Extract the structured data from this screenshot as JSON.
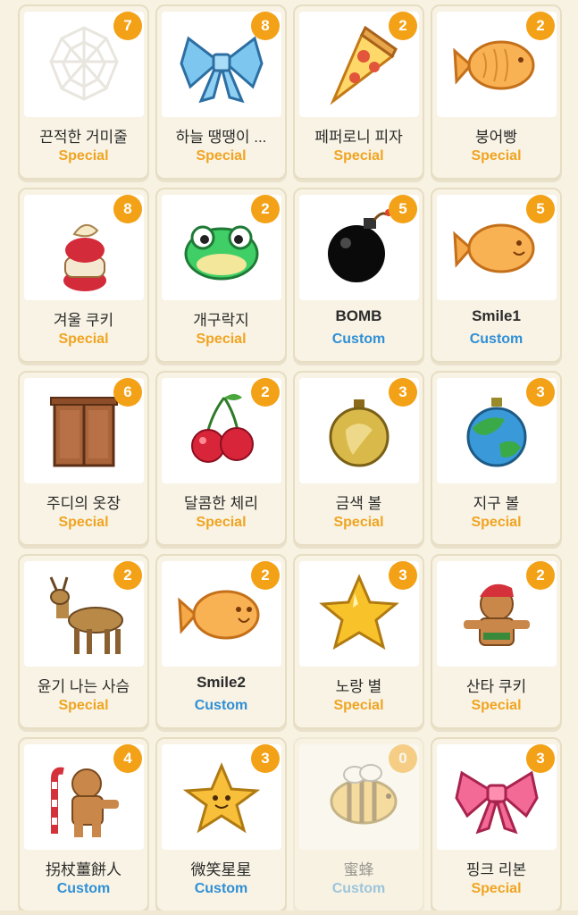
{
  "items": [
    {
      "name": "끈적한 거미줄",
      "category": "Special",
      "count": "7",
      "icon": "spiderweb-icon"
    },
    {
      "name": "하늘 땡땡이 ...",
      "category": "Special",
      "count": "8",
      "icon": "blue-bow-icon"
    },
    {
      "name": "페퍼로니 피자",
      "category": "Special",
      "count": "2",
      "icon": "pizza-icon"
    },
    {
      "name": "붕어빵",
      "category": "Special",
      "count": "2",
      "icon": "fish-bread-icon"
    },
    {
      "name": "겨울 쿠키",
      "category": "Special",
      "count": "8",
      "icon": "winter-cookie-icon"
    },
    {
      "name": "개구락지",
      "category": "Special",
      "count": "2",
      "icon": "frog-icon"
    },
    {
      "name": "BOMB",
      "category": "Custom",
      "count": "5",
      "icon": "bomb-icon"
    },
    {
      "name": "Smile1",
      "category": "Custom",
      "count": "5",
      "icon": "smiling-fish-icon"
    },
    {
      "name": "주디의 옷장",
      "category": "Special",
      "count": "6",
      "icon": "wardrobe-icon"
    },
    {
      "name": "달콤한 체리",
      "category": "Special",
      "count": "2",
      "icon": "cherry-icon"
    },
    {
      "name": "금색 볼",
      "category": "Special",
      "count": "3",
      "icon": "gold-ornament-icon"
    },
    {
      "name": "지구 볼",
      "category": "Special",
      "count": "3",
      "icon": "earth-ornament-icon"
    },
    {
      "name": "윤기 나는 사슴",
      "category": "Special",
      "count": "2",
      "icon": "deer-icon"
    },
    {
      "name": "Smile2",
      "category": "Custom",
      "count": "2",
      "icon": "smiling-fish-icon"
    },
    {
      "name": "노랑 별",
      "category": "Special",
      "count": "3",
      "icon": "yellow-star-icon"
    },
    {
      "name": "산타 쿠키",
      "category": "Special",
      "count": "2",
      "icon": "santa-cookie-icon"
    },
    {
      "name": "拐杖薑餅人",
      "category": "Custom",
      "count": "4",
      "icon": "gingerbread-cane-icon"
    },
    {
      "name": "微笑星星",
      "category": "Custom",
      "count": "3",
      "icon": "smiling-star-icon"
    },
    {
      "name": "蜜蜂",
      "category": "Custom",
      "count": "0",
      "icon": "bee-icon"
    },
    {
      "name": "핑크 리본",
      "category": "Special",
      "count": "3",
      "icon": "pink-bow-icon"
    }
  ]
}
